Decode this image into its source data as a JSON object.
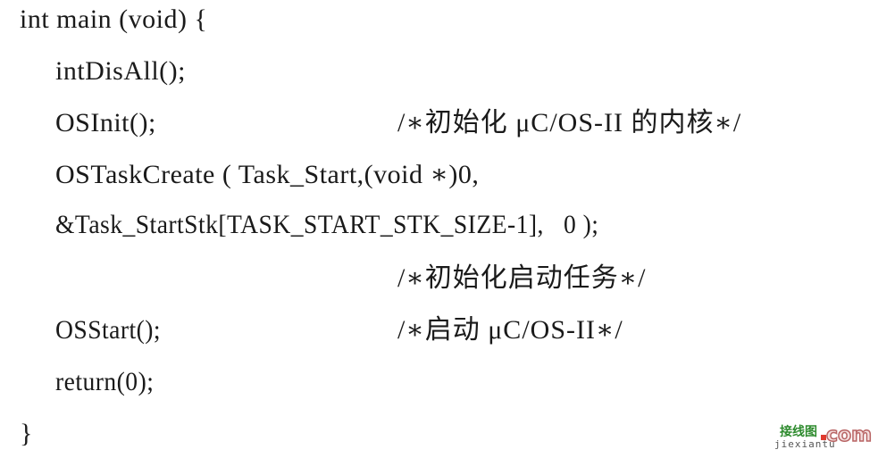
{
  "document": {
    "code_lines": [
      "int main (void) {",
      "intDisAll();",
      "OSInit();",
      "OSTaskCreate ( Task_Start,(void ∗)0,",
      "&Task_StartStk[TASK_START_STK_SIZE-1],   0 );",
      "",
      "OSStart();",
      "return(0);",
      "}"
    ],
    "comments": {
      "osinit": "/∗初始化 μC/OS-II 的内核∗/",
      "task_create": "/∗初始化启动任务∗/",
      "osstart": "/∗启动 μC/OS-II∗/"
    }
  },
  "watermark": {
    "chinese": "接线图",
    "pinyin": "jiexiantu",
    "suffix": "com"
  }
}
